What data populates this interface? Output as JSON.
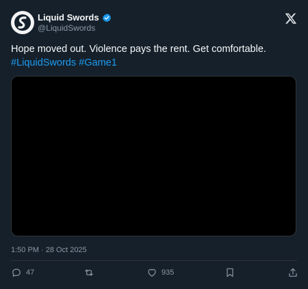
{
  "author": {
    "display_name": "Liquid Swords",
    "handle": "@LiquidSwords"
  },
  "tweet": {
    "text_plain": "Hope moved out. Violence pays the rent. Get comfortable.",
    "hashtags": [
      "#LiquidSwords",
      "#Game1"
    ]
  },
  "meta": {
    "timestamp": "1:50 PM · 28 Oct 2025"
  },
  "actions": {
    "replies": "47",
    "likes": "935"
  },
  "colors": {
    "background": "#15202b",
    "accent": "#1d9bf0",
    "muted": "#8b98a5",
    "media": "#000000"
  },
  "icons": {
    "avatar": "liquid-swords-logo-icon",
    "verified": "verified-badge-icon",
    "brand": "x-logo-icon",
    "reply": "reply-icon",
    "retweet": "retweet-icon",
    "like": "heart-icon",
    "bookmark": "bookmark-icon",
    "share": "share-icon"
  }
}
